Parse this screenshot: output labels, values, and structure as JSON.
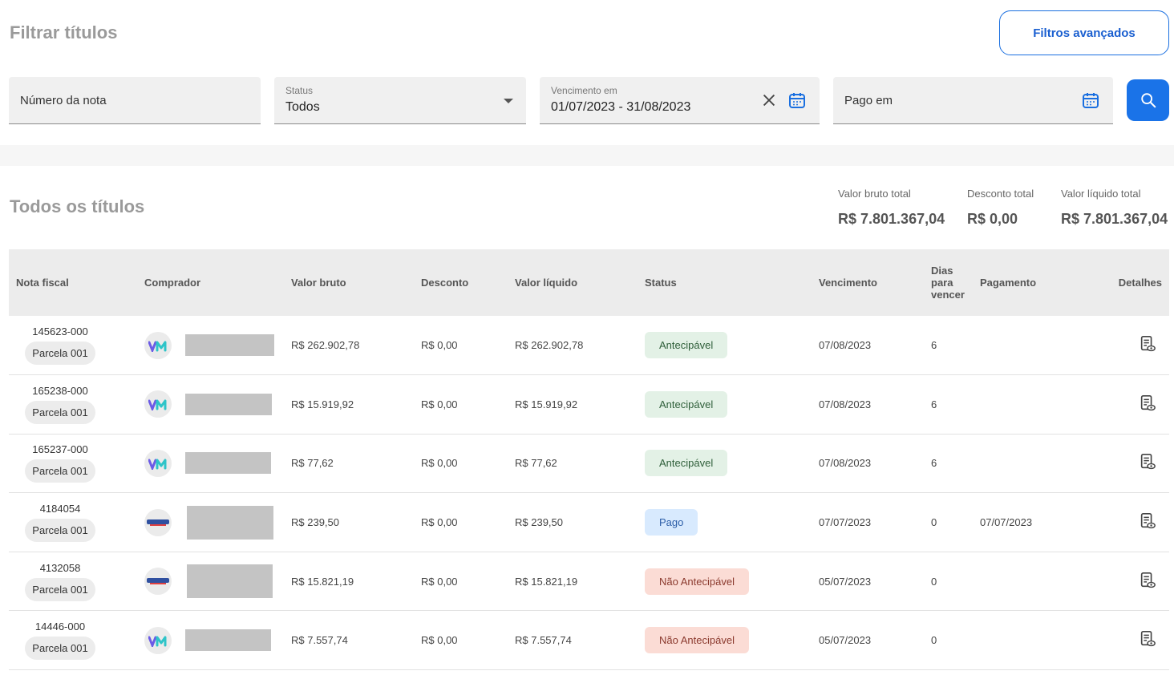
{
  "filters": {
    "title": "Filtrar títulos",
    "advanced_button": "Filtros avançados",
    "nota_placeholder": "Número da nota",
    "status_label": "Status",
    "status_value": "Todos",
    "vencimento_label": "Vencimento em",
    "vencimento_value": "01/07/2023 - 31/08/2023",
    "pago_placeholder": "Pago em"
  },
  "list": {
    "title": "Todos os títulos",
    "totals": [
      {
        "label": "Valor bruto total",
        "value": "R$ 7.801.367,04"
      },
      {
        "label": "Desconto total",
        "value": "R$ 0,00"
      },
      {
        "label": "Valor líquido total",
        "value": "R$ 7.801.367,04"
      }
    ],
    "columns": [
      "Nota fiscal",
      "Comprador",
      "Valor bruto",
      "Desconto",
      "Valor líquido",
      "Status",
      "Vencimento",
      "Dias para vencer",
      "Pagamento",
      "Detalhes"
    ],
    "rows": [
      {
        "nota": "145623-000",
        "parcela": "Parcela 001",
        "logo": "vm",
        "bruto": "R$ 262.902,78",
        "desconto": "R$ 0,00",
        "liquido": "R$ 262.902,78",
        "status": "Antecipável",
        "status_kind": "ant",
        "vencimento": "07/08/2023",
        "dias": "6",
        "pagamento": ""
      },
      {
        "nota": "165238-000",
        "parcela": "Parcela 001",
        "logo": "vm",
        "bruto": "R$ 15.919,92",
        "desconto": "R$ 0,00",
        "liquido": "R$ 15.919,92",
        "status": "Antecipável",
        "status_kind": "ant",
        "vencimento": "07/08/2023",
        "dias": "6",
        "pagamento": ""
      },
      {
        "nota": "165237-000",
        "parcela": "Parcela 001",
        "logo": "vm",
        "bruto": "R$ 77,62",
        "desconto": "R$ 0,00",
        "liquido": "R$ 77,62",
        "status": "Antecipável",
        "status_kind": "ant",
        "vencimento": "07/08/2023",
        "dias": "6",
        "pagamento": ""
      },
      {
        "nota": "4184054",
        "parcela": "Parcela 001",
        "logo": "bruning",
        "bruto": "R$ 239,50",
        "desconto": "R$ 0,00",
        "liquido": "R$ 239,50",
        "status": "Pago",
        "status_kind": "pago",
        "vencimento": "07/07/2023",
        "dias": "0",
        "pagamento": "07/07/2023"
      },
      {
        "nota": "4132058",
        "parcela": "Parcela 001",
        "logo": "bruning",
        "bruto": "R$ 15.821,19",
        "desconto": "R$ 0,00",
        "liquido": "R$ 15.821,19",
        "status": "Não Antecipável",
        "status_kind": "nao",
        "vencimento": "05/07/2023",
        "dias": "0",
        "pagamento": ""
      },
      {
        "nota": "14446-000",
        "parcela": "Parcela 001",
        "logo": "vm",
        "bruto": "R$ 7.557,74",
        "desconto": "R$ 0,00",
        "liquido": "R$ 7.557,74",
        "status": "Não Antecipável",
        "status_kind": "nao",
        "vencimento": "05/07/2023",
        "dias": "0",
        "pagamento": ""
      }
    ]
  }
}
